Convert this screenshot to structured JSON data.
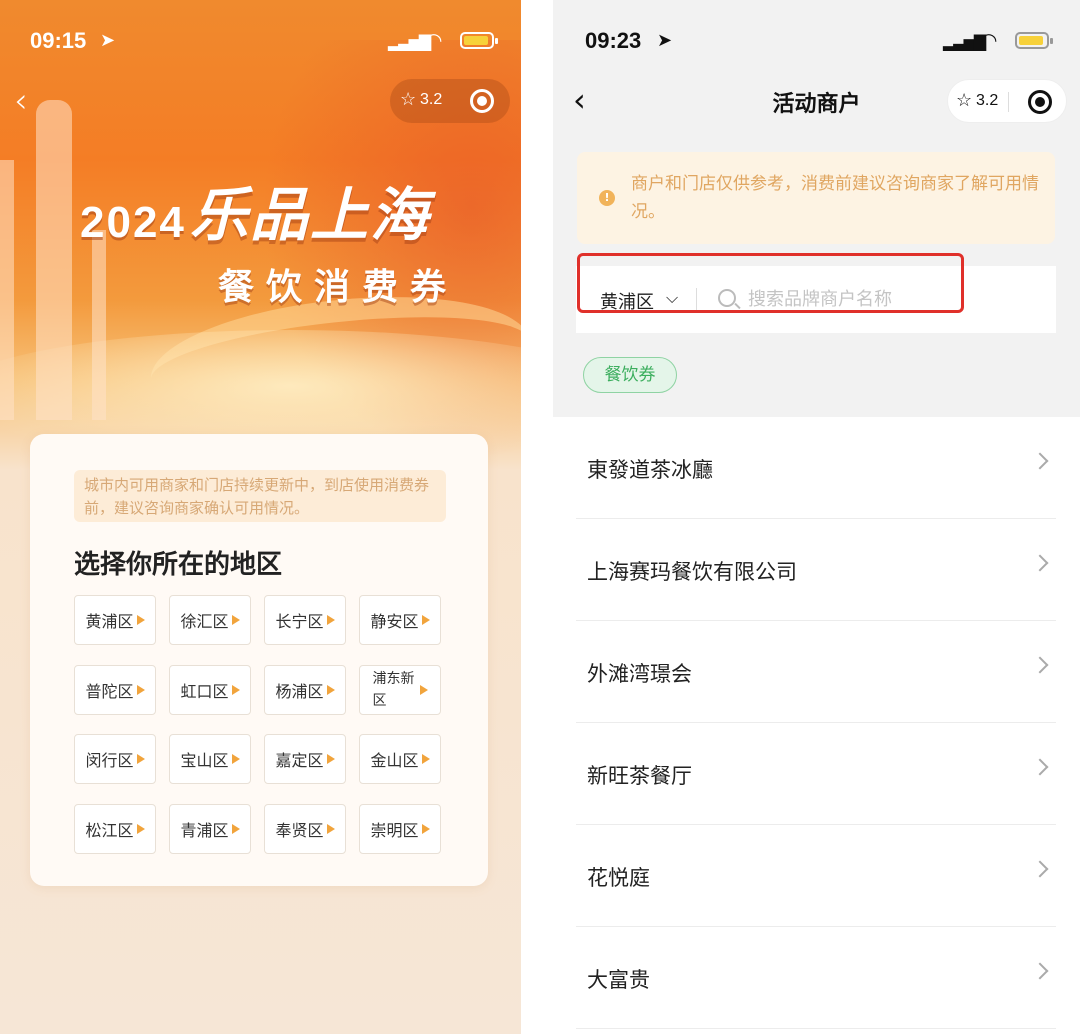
{
  "left_screen": {
    "status": {
      "time": "09:15"
    },
    "capsule": {
      "rating": "3.2"
    },
    "hero": {
      "year": "2024",
      "brand": "乐品上海",
      "subtitle": "餐饮消费券"
    },
    "notice": "城市内可用商家和门店持续更新中，到店使用消费券前，建议咨询商家确认可用情况。",
    "heading": "选择你所在的地区",
    "districts": [
      "黄浦区",
      "徐汇区",
      "长宁区",
      "静安区",
      "普陀区",
      "虹口区",
      "杨浦区",
      "浦东新区",
      "闵行区",
      "宝山区",
      "嘉定区",
      "金山区",
      "松江区",
      "青浦区",
      "奉贤区",
      "崇明区"
    ]
  },
  "right_screen": {
    "status": {
      "time": "09:23"
    },
    "title": "活动商户",
    "capsule": {
      "rating": "3.2"
    },
    "tip": "商户和门店仅供参考，消费前建议咨询商家了解可用情况。",
    "search": {
      "district": "黄浦区",
      "placeholder": "搜索品牌商户名称",
      "value": ""
    },
    "tag": "餐饮券",
    "merchants": [
      "東發道茶冰廳",
      "上海赛玛餐饮有限公司",
      "外滩湾璟会",
      "新旺茶餐厅",
      "花悦庭",
      "大富贵"
    ]
  },
  "colors": {
    "hero_orange": "#f47d25",
    "district_arrow": "#f1a43c",
    "tip_text": "#e0a661",
    "tag_green": "#3cae5e",
    "highlight_red": "#e0302a"
  },
  "icons": [
    "location-arrow-icon",
    "signal-icon",
    "wifi-icon",
    "battery-icon",
    "back-icon",
    "star-icon",
    "record-icon",
    "info-icon",
    "chevron-down-icon",
    "search-icon",
    "chevron-right-icon"
  ]
}
